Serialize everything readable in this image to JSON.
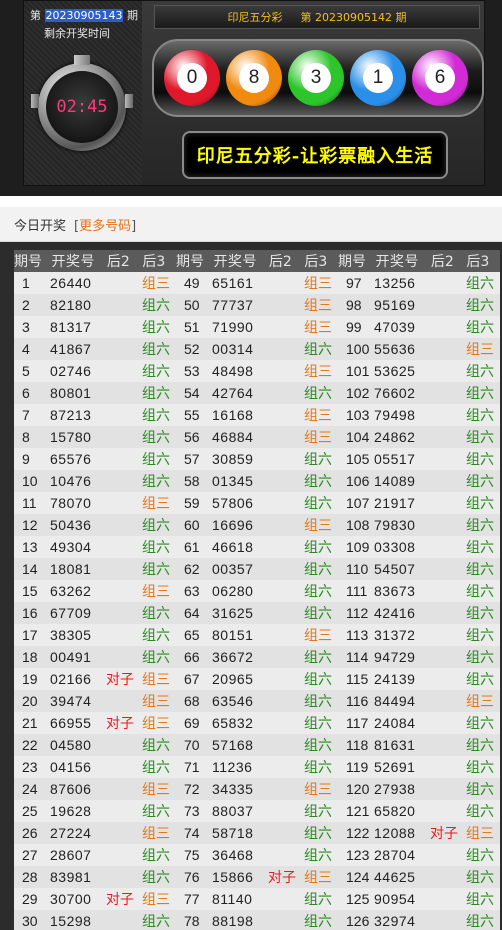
{
  "header": {
    "issue_prefix": "第",
    "current_issue": "20230905143",
    "issue_suffix": "期",
    "remain_label": "剩余开奖时间",
    "countdown": "02:45",
    "lottery_name": "印尼五分彩",
    "last_issue_label": "第 20230905142 期",
    "balls": [
      "0",
      "8",
      "3",
      "1",
      "6"
    ],
    "slogan": "印尼五分彩-让彩票融入生活"
  },
  "today": {
    "title": "今日开奖",
    "more_link": "更多号码",
    "bracket_open": "[",
    "bracket_close": "]"
  },
  "columns": [
    "期号",
    "开奖号",
    "后2",
    "后3"
  ],
  "results": [
    {
      "issue": "1",
      "num": "26440",
      "q2": "",
      "q3": "组三"
    },
    {
      "issue": "2",
      "num": "82180",
      "q2": "",
      "q3": "组六"
    },
    {
      "issue": "3",
      "num": "81317",
      "q2": "",
      "q3": "组六"
    },
    {
      "issue": "4",
      "num": "41867",
      "q2": "",
      "q3": "组六"
    },
    {
      "issue": "5",
      "num": "02746",
      "q2": "",
      "q3": "组六"
    },
    {
      "issue": "6",
      "num": "80801",
      "q2": "",
      "q3": "组六"
    },
    {
      "issue": "7",
      "num": "87213",
      "q2": "",
      "q3": "组六"
    },
    {
      "issue": "8",
      "num": "15780",
      "q2": "",
      "q3": "组六"
    },
    {
      "issue": "9",
      "num": "65576",
      "q2": "",
      "q3": "组六"
    },
    {
      "issue": "10",
      "num": "10476",
      "q2": "",
      "q3": "组六"
    },
    {
      "issue": "11",
      "num": "78070",
      "q2": "",
      "q3": "组三"
    },
    {
      "issue": "12",
      "num": "50436",
      "q2": "",
      "q3": "组六"
    },
    {
      "issue": "13",
      "num": "49304",
      "q2": "",
      "q3": "组六"
    },
    {
      "issue": "14",
      "num": "18081",
      "q2": "",
      "q3": "组六"
    },
    {
      "issue": "15",
      "num": "63262",
      "q2": "",
      "q3": "组三"
    },
    {
      "issue": "16",
      "num": "67709",
      "q2": "",
      "q3": "组六"
    },
    {
      "issue": "17",
      "num": "38305",
      "q2": "",
      "q3": "组六"
    },
    {
      "issue": "18",
      "num": "00491",
      "q2": "",
      "q3": "组六"
    },
    {
      "issue": "19",
      "num": "02166",
      "q2": "对子",
      "q3": "组三"
    },
    {
      "issue": "20",
      "num": "39474",
      "q2": "",
      "q3": "组三"
    },
    {
      "issue": "21",
      "num": "66955",
      "q2": "对子",
      "q3": "组三"
    },
    {
      "issue": "22",
      "num": "04580",
      "q2": "",
      "q3": "组六"
    },
    {
      "issue": "23",
      "num": "04156",
      "q2": "",
      "q3": "组六"
    },
    {
      "issue": "24",
      "num": "87606",
      "q2": "",
      "q3": "组三"
    },
    {
      "issue": "25",
      "num": "19628",
      "q2": "",
      "q3": "组六"
    },
    {
      "issue": "26",
      "num": "27224",
      "q2": "",
      "q3": "组三"
    },
    {
      "issue": "27",
      "num": "28607",
      "q2": "",
      "q3": "组六"
    },
    {
      "issue": "28",
      "num": "83981",
      "q2": "",
      "q3": "组六"
    },
    {
      "issue": "29",
      "num": "30700",
      "q2": "对子",
      "q3": "组三"
    },
    {
      "issue": "30",
      "num": "15298",
      "q2": "",
      "q3": "组六"
    },
    {
      "issue": "49",
      "num": "65161",
      "q2": "",
      "q3": "组三"
    },
    {
      "issue": "50",
      "num": "77737",
      "q2": "",
      "q3": "组三"
    },
    {
      "issue": "51",
      "num": "71990",
      "q2": "",
      "q3": "组三"
    },
    {
      "issue": "52",
      "num": "00314",
      "q2": "",
      "q3": "组六"
    },
    {
      "issue": "53",
      "num": "48498",
      "q2": "",
      "q3": "组三"
    },
    {
      "issue": "54",
      "num": "42764",
      "q2": "",
      "q3": "组六"
    },
    {
      "issue": "55",
      "num": "16168",
      "q2": "",
      "q3": "组三"
    },
    {
      "issue": "56",
      "num": "46884",
      "q2": "",
      "q3": "组三"
    },
    {
      "issue": "57",
      "num": "30859",
      "q2": "",
      "q3": "组六"
    },
    {
      "issue": "58",
      "num": "01345",
      "q2": "",
      "q3": "组六"
    },
    {
      "issue": "59",
      "num": "57806",
      "q2": "",
      "q3": "组六"
    },
    {
      "issue": "60",
      "num": "16696",
      "q2": "",
      "q3": "组三"
    },
    {
      "issue": "61",
      "num": "46618",
      "q2": "",
      "q3": "组六"
    },
    {
      "issue": "62",
      "num": "00357",
      "q2": "",
      "q3": "组六"
    },
    {
      "issue": "63",
      "num": "06280",
      "q2": "",
      "q3": "组六"
    },
    {
      "issue": "64",
      "num": "31625",
      "q2": "",
      "q3": "组六"
    },
    {
      "issue": "65",
      "num": "80151",
      "q2": "",
      "q3": "组三"
    },
    {
      "issue": "66",
      "num": "36672",
      "q2": "",
      "q3": "组六"
    },
    {
      "issue": "67",
      "num": "20965",
      "q2": "",
      "q3": "组六"
    },
    {
      "issue": "68",
      "num": "63546",
      "q2": "",
      "q3": "组六"
    },
    {
      "issue": "69",
      "num": "65832",
      "q2": "",
      "q3": "组六"
    },
    {
      "issue": "70",
      "num": "57168",
      "q2": "",
      "q3": "组六"
    },
    {
      "issue": "71",
      "num": "11236",
      "q2": "",
      "q3": "组六"
    },
    {
      "issue": "72",
      "num": "34335",
      "q2": "",
      "q3": "组三"
    },
    {
      "issue": "73",
      "num": "88037",
      "q2": "",
      "q3": "组六"
    },
    {
      "issue": "74",
      "num": "58718",
      "q2": "",
      "q3": "组六"
    },
    {
      "issue": "75",
      "num": "36468",
      "q2": "",
      "q3": "组六"
    },
    {
      "issue": "76",
      "num": "15866",
      "q2": "对子",
      "q3": "组三"
    },
    {
      "issue": "77",
      "num": "81140",
      "q2": "",
      "q3": "组六"
    },
    {
      "issue": "78",
      "num": "88198",
      "q2": "",
      "q3": "组六"
    },
    {
      "issue": "97",
      "num": "13256",
      "q2": "",
      "q3": "组六"
    },
    {
      "issue": "98",
      "num": "95169",
      "q2": "",
      "q3": "组六"
    },
    {
      "issue": "99",
      "num": "47039",
      "q2": "",
      "q3": "组六"
    },
    {
      "issue": "100",
      "num": "55636",
      "q2": "",
      "q3": "组三"
    },
    {
      "issue": "101",
      "num": "53625",
      "q2": "",
      "q3": "组六"
    },
    {
      "issue": "102",
      "num": "76602",
      "q2": "",
      "q3": "组六"
    },
    {
      "issue": "103",
      "num": "79498",
      "q2": "",
      "q3": "组六"
    },
    {
      "issue": "104",
      "num": "24862",
      "q2": "",
      "q3": "组六"
    },
    {
      "issue": "105",
      "num": "05517",
      "q2": "",
      "q3": "组六"
    },
    {
      "issue": "106",
      "num": "14089",
      "q2": "",
      "q3": "组六"
    },
    {
      "issue": "107",
      "num": "21917",
      "q2": "",
      "q3": "组六"
    },
    {
      "issue": "108",
      "num": "79830",
      "q2": "",
      "q3": "组六"
    },
    {
      "issue": "109",
      "num": "03308",
      "q2": "",
      "q3": "组六"
    },
    {
      "issue": "110",
      "num": "54507",
      "q2": "",
      "q3": "组六"
    },
    {
      "issue": "111",
      "num": "83673",
      "q2": "",
      "q3": "组六"
    },
    {
      "issue": "112",
      "num": "42416",
      "q2": "",
      "q3": "组六"
    },
    {
      "issue": "113",
      "num": "31372",
      "q2": "",
      "q3": "组六"
    },
    {
      "issue": "114",
      "num": "94729",
      "q2": "",
      "q3": "组六"
    },
    {
      "issue": "115",
      "num": "24139",
      "q2": "",
      "q3": "组六"
    },
    {
      "issue": "116",
      "num": "84494",
      "q2": "",
      "q3": "组三"
    },
    {
      "issue": "117",
      "num": "24084",
      "q2": "",
      "q3": "组六"
    },
    {
      "issue": "118",
      "num": "81631",
      "q2": "",
      "q3": "组六"
    },
    {
      "issue": "119",
      "num": "52691",
      "q2": "",
      "q3": "组六"
    },
    {
      "issue": "120",
      "num": "27938",
      "q2": "",
      "q3": "组六"
    },
    {
      "issue": "121",
      "num": "65820",
      "q2": "",
      "q3": "组六"
    },
    {
      "issue": "122",
      "num": "12088",
      "q2": "对子",
      "q3": "组三"
    },
    {
      "issue": "123",
      "num": "28704",
      "q2": "",
      "q3": "组六"
    },
    {
      "issue": "124",
      "num": "44625",
      "q2": "",
      "q3": "组六"
    },
    {
      "issue": "125",
      "num": "90954",
      "q2": "",
      "q3": "组六"
    },
    {
      "issue": "126",
      "num": "32974",
      "q2": "",
      "q3": "组六"
    }
  ],
  "colors": {
    "zuliu": "#2a8a1f",
    "zusan": "#e2781a",
    "duizi": "#e81c1c",
    "ball_red": "#e0182c",
    "ball_orange": "#f08a10",
    "ball_green": "#2cc52a",
    "ball_blue": "#2a8fe8",
    "ball_magenta": "#d12ad6",
    "slogan": "#ffff00",
    "countdown": "#ff3a7a"
  }
}
